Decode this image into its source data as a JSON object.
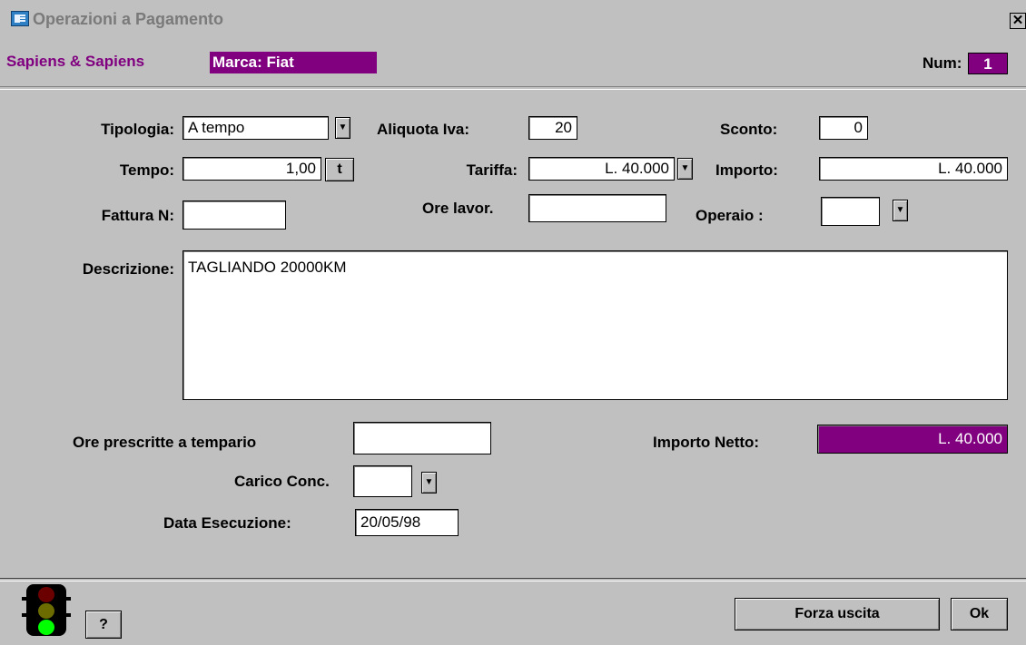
{
  "window": {
    "title": "Operazioni a Pagamento",
    "close_glyph": "✕"
  },
  "header": {
    "company": "Sapiens & Sapiens",
    "marca": "Marca: Fiat",
    "num_label": "Num:",
    "num_value": "1"
  },
  "form": {
    "tipologia": {
      "label": "Tipologia:",
      "value": "A tempo"
    },
    "aliquota_iva": {
      "label": "Aliquota Iva:",
      "value": "20"
    },
    "sconto": {
      "label": "Sconto:",
      "value": "0"
    },
    "tempo": {
      "label": "Tempo:",
      "value": "1,00",
      "button": "t"
    },
    "tariffa": {
      "label": "Tariffa:",
      "value": "L. 40.000"
    },
    "importo": {
      "label": "Importo:",
      "value": "L. 40.000"
    },
    "fattura": {
      "label": "Fattura N:",
      "value": ""
    },
    "ore_lavor": {
      "label": "Ore lavor.",
      "value": ""
    },
    "operaio": {
      "label": "Operaio :",
      "value": ""
    },
    "descrizione": {
      "label": "Descrizione:",
      "value": "TAGLIANDO 20000KM"
    },
    "ore_prescritte": {
      "label": "Ore prescritte a tempario",
      "value": ""
    },
    "importo_netto": {
      "label": "Importo Netto:",
      "value": "L. 40.000"
    },
    "carico_conc": {
      "label": "Carico Conc.",
      "value": ""
    },
    "data_esecuzione": {
      "label": "Data Esecuzione:",
      "value": "20/05/98"
    }
  },
  "footer": {
    "help_label": "?",
    "forza_uscita": "Forza uscita",
    "ok": "Ok"
  },
  "icons": {
    "dropdown": "dropdown-arrow-icon",
    "traffic_light": "traffic-light-icon"
  },
  "colors": {
    "accent": "#800080",
    "background": "#c0c0c0",
    "light_red": "#6b0000",
    "light_yellow": "#6b6b00",
    "light_green": "#00ff00"
  }
}
